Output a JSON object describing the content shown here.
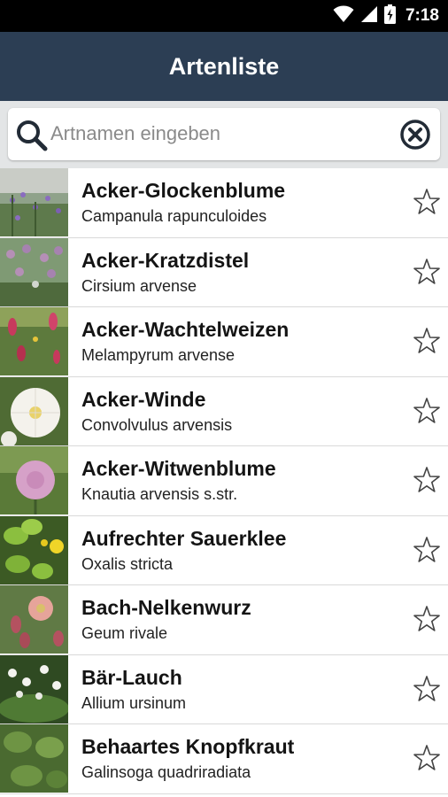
{
  "status_bar": {
    "time": "7:18",
    "icons": [
      "wifi-icon",
      "signal-icon",
      "battery-charging-icon"
    ]
  },
  "header": {
    "title": "Artenliste",
    "background": "#2c3e54"
  },
  "search": {
    "placeholder": "Artnamen eingeben",
    "value": "",
    "search_icon": "search-icon",
    "clear_icon": "clear-icon"
  },
  "species": [
    {
      "common": "Acker-Glockenblume",
      "scientific": "Campanula rapunculoides",
      "favorite": false
    },
    {
      "common": "Acker-Kratzdistel",
      "scientific": "Cirsium arvense",
      "favorite": false
    },
    {
      "common": "Acker-Wachtelweizen",
      "scientific": "Melampyrum arvense",
      "favorite": false
    },
    {
      "common": "Acker-Winde",
      "scientific": "Convolvulus arvensis",
      "favorite": false
    },
    {
      "common": "Acker-Witwenblume",
      "scientific": "Knautia arvensis s.str.",
      "favorite": false
    },
    {
      "common": "Aufrechter Sauerklee",
      "scientific": "Oxalis stricta",
      "favorite": false
    },
    {
      "common": "Bach-Nelkenwurz",
      "scientific": "Geum rivale",
      "favorite": false
    },
    {
      "common": "Bär-Lauch",
      "scientific": "Allium ursinum",
      "favorite": false
    },
    {
      "common": "Behaartes Knopfkraut",
      "scientific": "Galinsoga quadriradiata",
      "favorite": false
    }
  ]
}
